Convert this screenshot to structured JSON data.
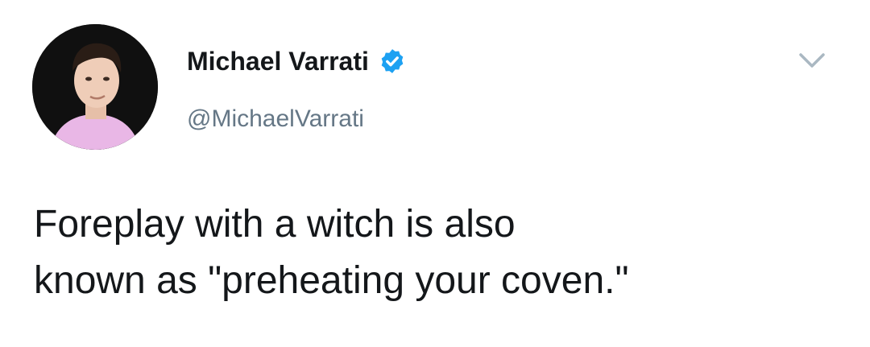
{
  "tweet": {
    "author": {
      "display_name": "Michael Varrati",
      "handle": "@MichaelVarrati",
      "verified": true,
      "avatar_icon": "profile-photo"
    },
    "text_line_1": "Foreplay with a witch is also",
    "text_line_2": "known as \"preheating your coven.\"",
    "menu_icon": "chevron-down-icon"
  },
  "colors": {
    "verified_blue": "#1da1f2",
    "handle_gray": "#657786",
    "text": "#14171a",
    "caret_gray": "#aab8c2"
  }
}
